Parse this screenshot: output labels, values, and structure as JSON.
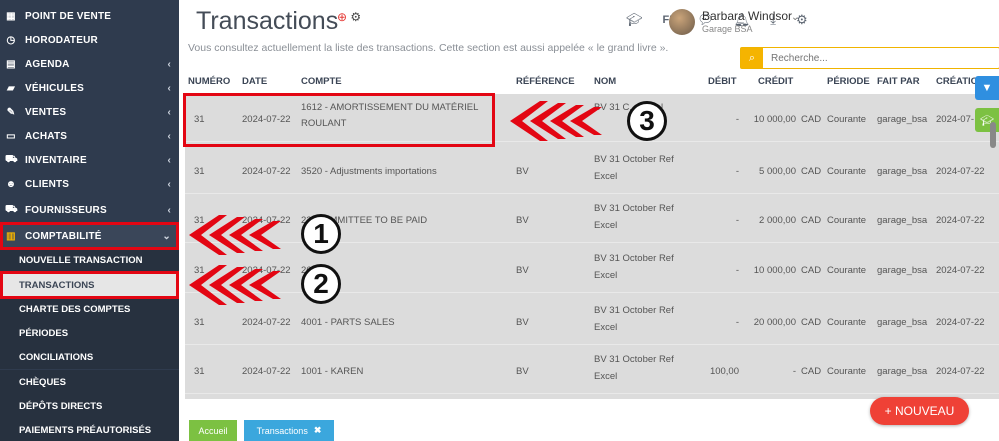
{
  "sidebar": {
    "items": [
      {
        "label": "POINT DE VENTE",
        "icon": "barcode-icon"
      },
      {
        "label": "HORODATEUR",
        "icon": "clock-icon"
      },
      {
        "label": "AGENDA",
        "icon": "calendar-icon"
      },
      {
        "label": "VÉHICULES",
        "icon": "car-icon"
      },
      {
        "label": "VENTES",
        "icon": "edit-icon"
      },
      {
        "label": "ACHATS",
        "icon": "credit-card-icon"
      },
      {
        "label": "INVENTAIRE",
        "icon": "cart-icon"
      },
      {
        "label": "CLIENTS",
        "icon": "users-icon"
      },
      {
        "label": "FOURNISSEURS",
        "icon": "truck-icon"
      },
      {
        "label": "COMPTABILITÉ",
        "icon": "bar-chart-icon"
      }
    ],
    "subitems": [
      "NOUVELLE TRANSACTION",
      "TRANSACTIONS",
      "CHARTE DES COMPTES",
      "PÉRIODES",
      "CONCILIATIONS",
      "CHÈQUES",
      "DÉPÔTS DIRECTS",
      "PAIEMENTS PRÉAUTORISÉS"
    ]
  },
  "page": {
    "title": "Transactions",
    "subtitle": "Vous consultez actuellement la liste des transactions. Cette section est aussi appelée « le grand livre »."
  },
  "header": {
    "language": "FR",
    "user_name": "Barbara Windsor",
    "company": "Garage BSA"
  },
  "search": {
    "placeholder": "Recherche..."
  },
  "table": {
    "headers": [
      "NUMÉRO",
      "DATE",
      "COMPTE",
      "RÉFÉRENCE",
      "NOM",
      "DÉBIT",
      "CRÉDIT",
      "PÉRIODE",
      "FAIT PAR",
      "CRÉATIO"
    ],
    "rows": [
      {
        "numero": "31",
        "date": "2024-07-22",
        "compte": "1612 - AMORTISSEMENT DU MATÉRIEL ROULANT",
        "reference": "",
        "nom": "BV 31 C... Excel",
        "debit": "-",
        "credit": "10 000,00",
        "currency": "CAD",
        "periode": "Courante",
        "fait_par": "garage_bsa",
        "creation": "2024-07-"
      },
      {
        "numero": "31",
        "date": "2024-07-22",
        "compte": "3520 - Adjustments importations",
        "reference": "BV",
        "nom": "BV 31 October Ref Excel",
        "debit": "-",
        "credit": "5 000,00",
        "currency": "CAD",
        "periode": "Courante",
        "fait_par": "garage_bsa",
        "creation": "2024-07-22"
      },
      {
        "numero": "31",
        "date": "2024-07-22",
        "compte": "22... OMMITTEE TO BE PAID",
        "reference": "BV",
        "nom": "BV 31 October Ref Excel",
        "debit": "-",
        "credit": "2 000,00",
        "currency": "CAD",
        "periode": "Courante",
        "fait_par": "garage_bsa",
        "creation": "2024-07-22"
      },
      {
        "numero": "31",
        "date": "2024-07-22",
        "compte": "26...",
        "reference": "BV",
        "nom": "BV 31 October Ref Excel",
        "debit": "-",
        "credit": "10 000,00",
        "currency": "CAD",
        "periode": "Courante",
        "fait_par": "garage_bsa",
        "creation": "2024-07-22"
      },
      {
        "numero": "31",
        "date": "2024-07-22",
        "compte": "4001 - PARTS SALES",
        "reference": "BV",
        "nom": "BV 31 October Ref Excel",
        "debit": "-",
        "credit": "20 000,00",
        "currency": "CAD",
        "periode": "Courante",
        "fait_par": "garage_bsa",
        "creation": "2024-07-22"
      },
      {
        "numero": "31",
        "date": "2024-07-22",
        "compte": "1001 - KAREN",
        "reference": "BV",
        "nom": "BV 31 October Ref Excel",
        "debit": "100,00",
        "credit": "-",
        "currency": "CAD",
        "periode": "Courante",
        "fait_par": "garage_bsa",
        "creation": "2024-07-22"
      }
    ]
  },
  "bottom_tabs": {
    "home": "Accueil",
    "current": "Transactions"
  },
  "actions": {
    "new_button": "+ NOUVEAU"
  },
  "annotations": {
    "step1": "1",
    "step2": "2",
    "step3": "3"
  },
  "colors": {
    "annotation_red": "#e30613",
    "sidebar_bg": "#2f3b4e",
    "accent_yellow": "#f5b400",
    "new_button": "#ef4136"
  }
}
